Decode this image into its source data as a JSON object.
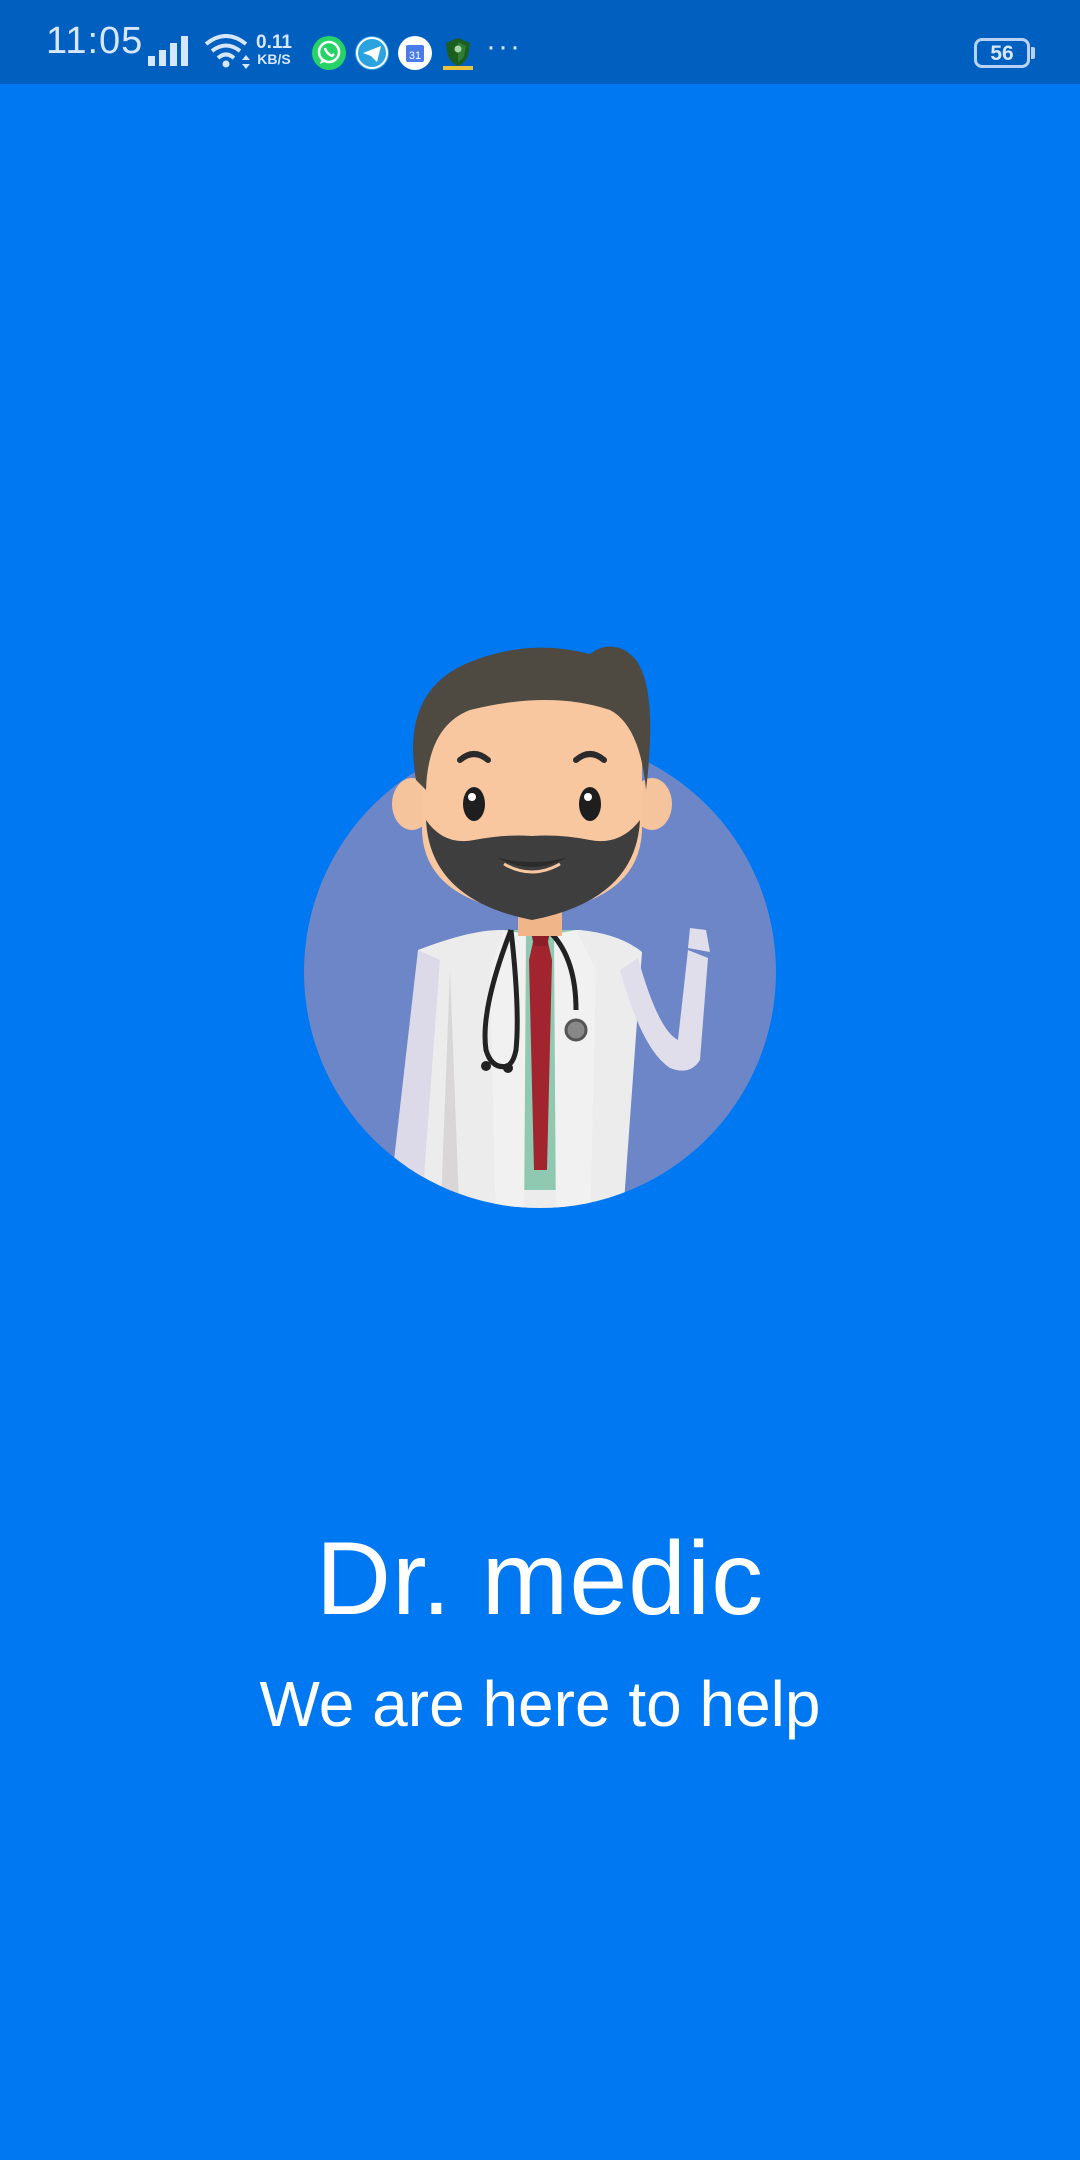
{
  "status_bar": {
    "time": "11:05",
    "net_speed_value": "0.11",
    "net_speed_unit": "KB/S",
    "battery_level": "56",
    "more_glyph": "···",
    "icons": [
      "signal-icon",
      "wifi-icon",
      "whatsapp-icon",
      "telegram-icon",
      "calendar-icon",
      "shield-app-icon"
    ],
    "calendar_day": "31"
  },
  "splash": {
    "title": "Dr. medic",
    "tagline": "We are here to help",
    "illustration": "doctor-avatar-illustration"
  },
  "colors": {
    "background": "#0078F2",
    "status_bar": "#005FBF",
    "circle": "#6D86C8",
    "text": "#FFFFFF"
  }
}
